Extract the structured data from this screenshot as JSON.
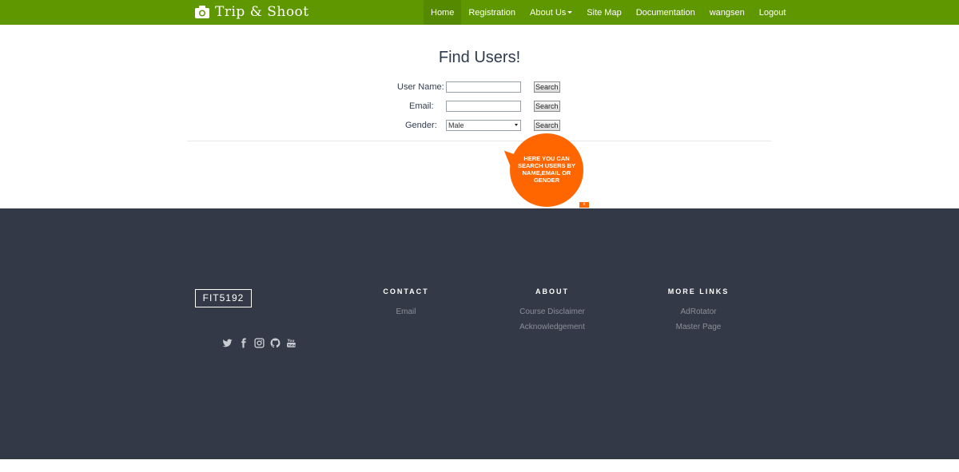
{
  "brand": {
    "name": "Trip & Shoot",
    "icon": "camera-icon"
  },
  "nav": {
    "items": [
      {
        "label": "Home",
        "active": true
      },
      {
        "label": "Registration"
      },
      {
        "label": "About Us",
        "dropdown": true
      },
      {
        "label": "Site Map"
      },
      {
        "label": "Documentation"
      },
      {
        "label": "wangsen"
      },
      {
        "label": "Logout"
      }
    ]
  },
  "main": {
    "title": "Find Users!",
    "username": {
      "label": "User Name:",
      "value": "",
      "button": "Search"
    },
    "email": {
      "label": "Email:",
      "value": "",
      "button": "Search"
    },
    "gender": {
      "label": "Gender:",
      "selected": "Male",
      "button": "Search"
    }
  },
  "tooltip": {
    "text": "HERE YOU CAN SEARCH USERS BY NAME,EMAIL OR GENDER",
    "close": "x",
    "color": "#ff6600"
  },
  "footer": {
    "logo": "FIT5192",
    "social_icons": [
      "twitter-icon",
      "facebook-icon",
      "instagram-icon",
      "github-icon",
      "youtube-icon"
    ],
    "contact": {
      "heading": "CONTACT",
      "links": [
        "Email"
      ]
    },
    "about": {
      "heading": "ABOUT",
      "links": [
        "Course Disclaimer",
        "Acknowledgement"
      ]
    },
    "more": {
      "heading": "MORE LINKS",
      "links": [
        "AdRotator",
        "Master Page"
      ]
    }
  },
  "colors": {
    "navbar": "#5f9700",
    "footer": "#333946",
    "accent": "#ff6600"
  }
}
